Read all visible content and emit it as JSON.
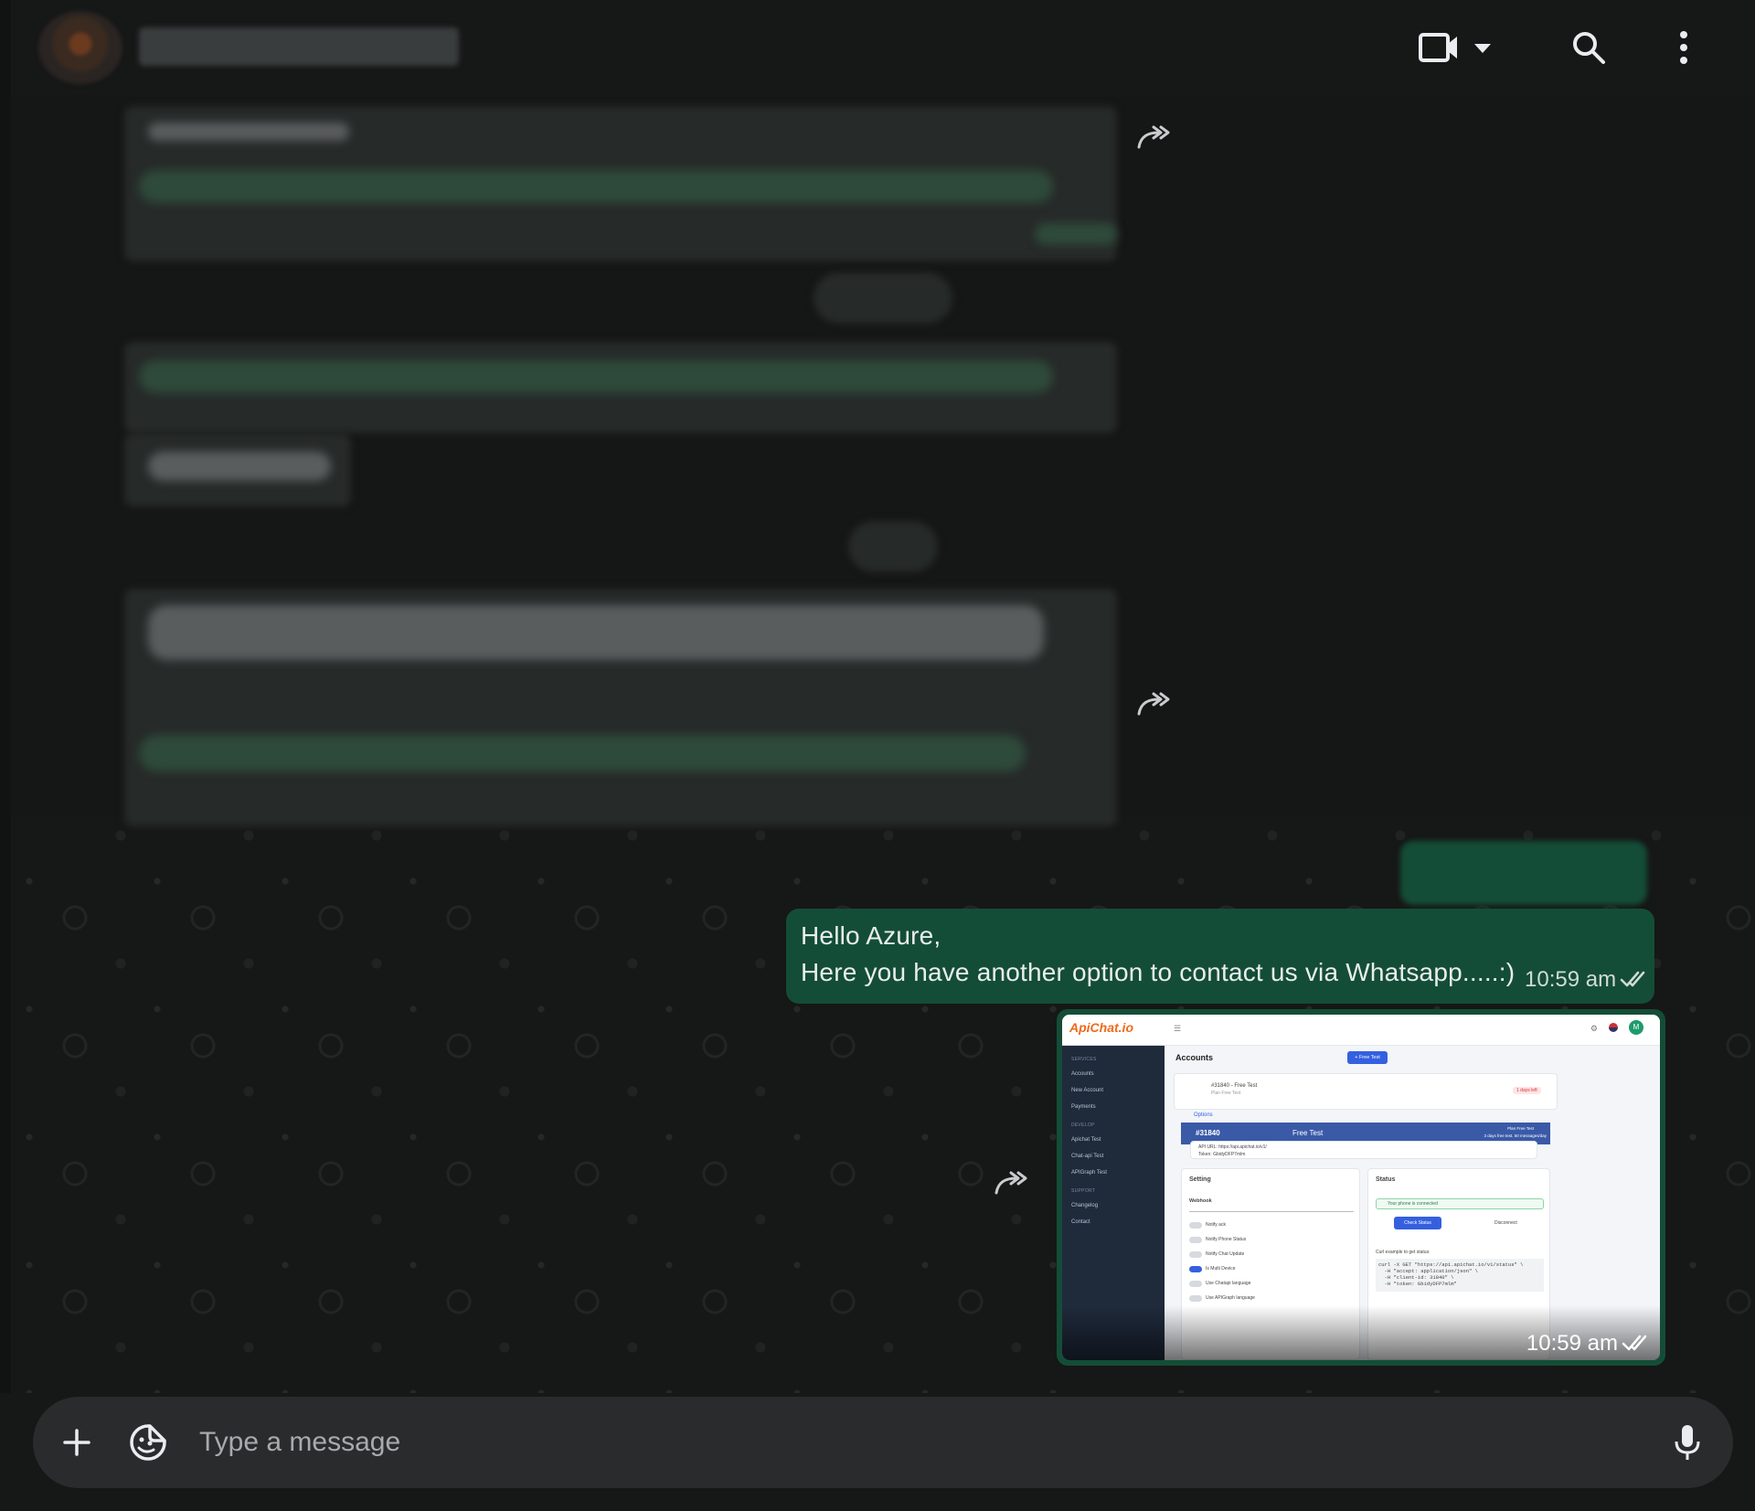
{
  "header": {
    "contact_name": "",
    "icons": [
      "video-call-icon",
      "chevron-down-icon",
      "search-icon",
      "menu-icon"
    ]
  },
  "messages": [
    {
      "direction": "outgoing",
      "lines": [
        "Hello Azure,",
        "Here you have another option to contact us via Whatsapp.....:)"
      ],
      "time": "10:59 am",
      "status": "read"
    },
    {
      "direction": "outgoing",
      "type": "image",
      "time": "10:59 am",
      "status": "read",
      "screenshot": {
        "logo": "ApiChat.io",
        "page_title": "Accounts",
        "free_test_button": "+ Free Test",
        "sidebar": {
          "services_heading": "SERVICES",
          "services": [
            "Accounts",
            "New Account",
            "Payments"
          ],
          "develop_heading": "DEVELOP",
          "develop": [
            "Apichat Test",
            "Chat-api Test",
            "APIGraph Test"
          ],
          "support_heading": "SUPPORT",
          "support": [
            "Changelog",
            "Contact"
          ]
        },
        "account_label": "#31840 - Free Test",
        "account_sub": "Plan Free Test",
        "days_left": "1 days left",
        "options_label": "Options",
        "banner_id": "#31840",
        "banner_plan": "Free Test",
        "banner_right_1": "Plan Free Test",
        "banner_right_2": "3 days free test. 50 messages/day",
        "api_url": "API URL: https://api.apichat.io/v1/",
        "token": "Token: GbidyDFP7mlm",
        "setting_title": "Setting",
        "webhook_label": "Webhook",
        "toggles": [
          "Notify ack",
          "Notify Phone Status",
          "Notify Chat Update",
          "Is Multi Device",
          "Use Chatapi language",
          "Use APIGraph language"
        ],
        "status_title": "Status",
        "status_connected": "Your phone is connected",
        "check_status_button": "Check Status",
        "disconnect_button": "Disconnect",
        "curl_label": "Curl example to get status:",
        "curl_code": "curl -X GET \"https://api.apichat.io/v1/status\" \\\n  -H \"accept: application/json\" \\\n  -H \"client-id: 31840\" \\\n  -H \"token: GbidyDFP7mlm\""
      }
    }
  ],
  "composer": {
    "placeholder": "Type a message"
  },
  "colors": {
    "background": "#161717",
    "outgoing_bubble": "#144d37",
    "composer": "#2a2b2c",
    "text": "#e9edef"
  }
}
